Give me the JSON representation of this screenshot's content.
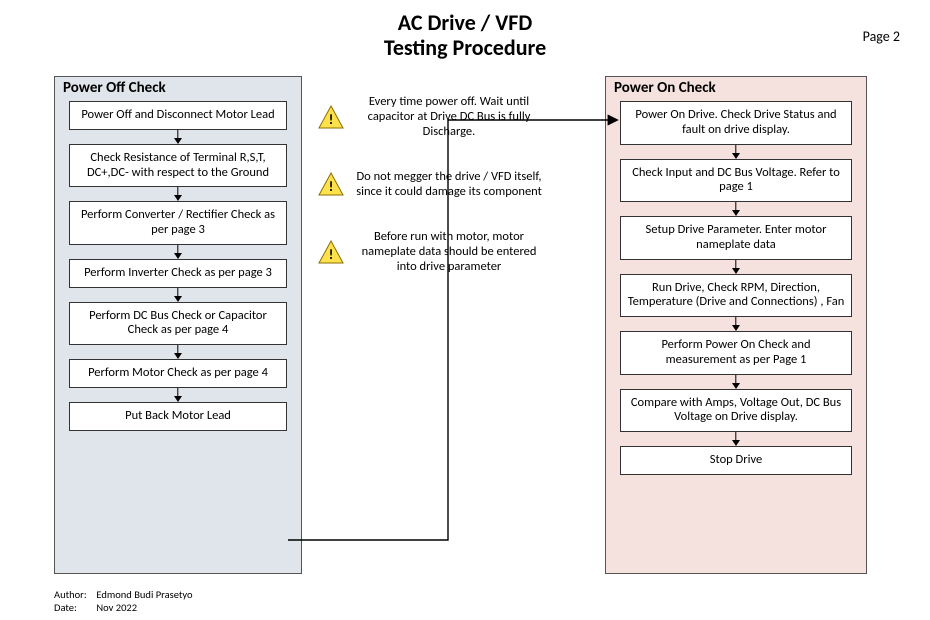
{
  "title_line1": "AC Drive / VFD",
  "title_line2": "Testing Procedure",
  "page_label": "Page 2",
  "left": {
    "title": "Power Off Check",
    "steps": [
      "Power Off and Disconnect Motor Lead",
      "Check Resistance of Terminal R,S,T, DC+,DC- with respect to the Ground",
      "Perform Converter / Rectifier Check as per page 3",
      "Perform Inverter Check as per page 3",
      "Perform DC Bus Check or Capacitor Check as per page 4",
      "Perform Motor Check as per page 4",
      "Put Back Motor Lead"
    ]
  },
  "right": {
    "title": "Power On Check",
    "steps": [
      "Power On Drive. Check Drive Status and fault on drive display.",
      "Check Input and DC Bus Voltage. Refer to page 1",
      "Setup Drive Parameter. Enter motor nameplate data",
      "Run Drive, Check RPM, Direction, Temperature (Drive and Connections) , Fan",
      "Perform Power On Check and measurement as per Page 1",
      "Compare with Amps, Voltage Out, DC Bus Voltage on Drive display.",
      "Stop Drive"
    ]
  },
  "warnings": [
    "Every time power off. Wait until capacitor at Drive DC Bus is fully Discharge.",
    "Do not megger the drive / VFD itself, since it could damage its component",
    "Before run with motor, motor nameplate data should be entered into drive parameter"
  ],
  "footer": {
    "author_label": "Author:",
    "author": "Edmond Budi Prasetyo",
    "date_label": "Date:",
    "date": "Nov 2022"
  }
}
